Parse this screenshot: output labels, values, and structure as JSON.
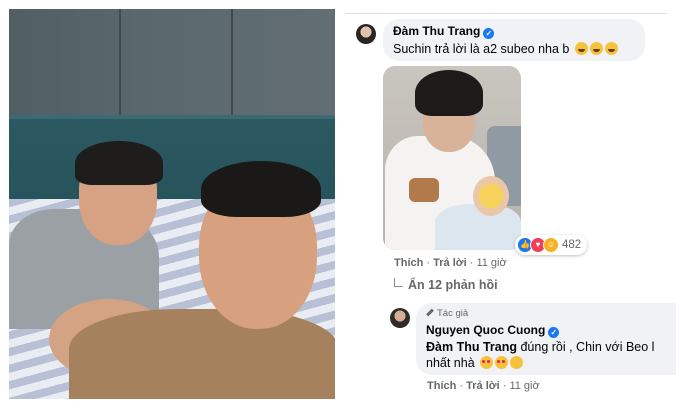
{
  "comment1": {
    "author": "Đàm Thu Trang",
    "text": "Suchin trả lời là a2 subeo nha b",
    "emojis": [
      "grin-squint",
      "grin-squint",
      "grin-squint"
    ],
    "reaction_count": "482",
    "reactions": [
      "like",
      "love",
      "haha"
    ],
    "action_like": "Thích",
    "action_reply": "Trả lời",
    "time": "11 giờ"
  },
  "hide_replies": "Ẩn 12 phản hồi",
  "reply": {
    "badge": "Tác giả",
    "author": "Nguyen Quoc Cuong",
    "mention": "Đàm Thu Trang",
    "text_line1": "đúng rồi , Chin với Beo l",
    "text_line2": "nhất nhà",
    "emojis": [
      "heart-eyes",
      "smiling-hearts",
      "kissing"
    ],
    "action_like": "Thích",
    "action_reply": "Trả lời",
    "time": "11 giờ"
  },
  "colors": {
    "verified": "#1877f2",
    "bubble": "#f0f2f5",
    "meta_text": "#65676b"
  }
}
